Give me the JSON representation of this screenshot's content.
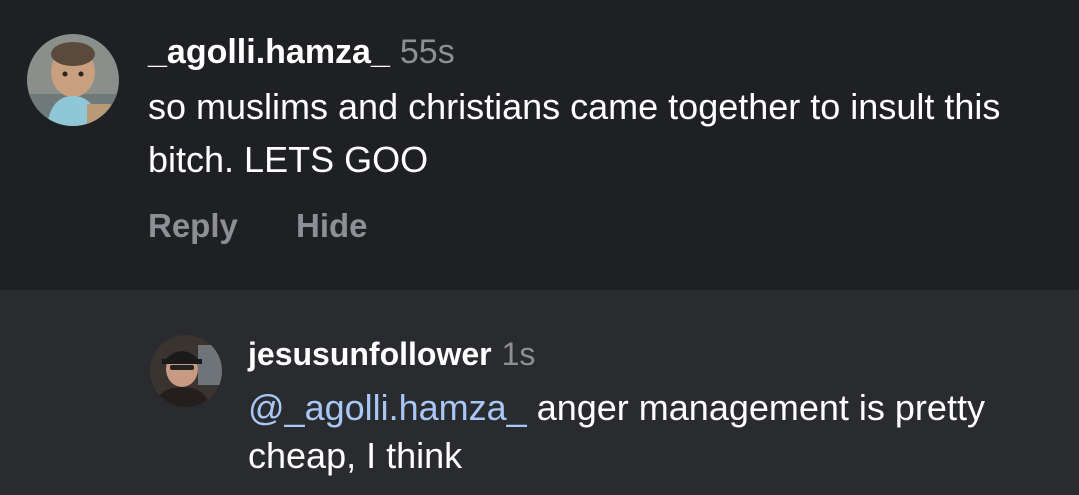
{
  "comments": [
    {
      "username": "_agolli.hamza_",
      "time": "55s",
      "text": "so muslims and christians came together to insult this bitch. LETS GOO",
      "actions": {
        "reply": "Reply",
        "hide": "Hide"
      }
    },
    {
      "username": "jesusunfollower",
      "time": "1s",
      "mention": "@_agolli.hamza_",
      "text": " anger management is pretty cheap, I think"
    }
  ],
  "colors": {
    "background": "#1f2024",
    "reply_background": "#2a2b2f",
    "muted": "#8e8f94",
    "mention": "#a8c7f7"
  }
}
